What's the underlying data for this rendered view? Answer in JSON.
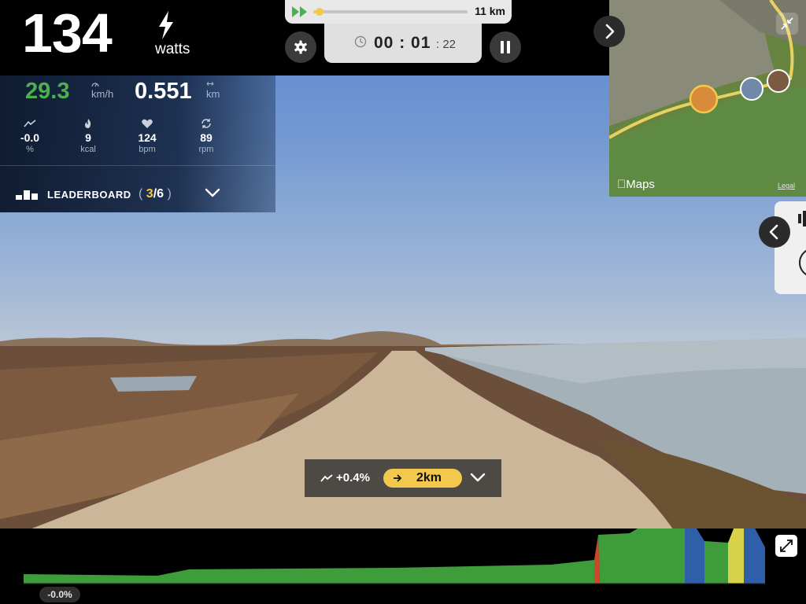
{
  "power": {
    "value": "134",
    "unit": "watts"
  },
  "route": {
    "total_distance": "11 km",
    "progress_fraction": 0.04
  },
  "timer": {
    "hours": "00",
    "minutes": "01",
    "seconds": "22"
  },
  "stats": {
    "speed": {
      "value": "29.3",
      "unit": "km/h"
    },
    "distance": {
      "value": "0.551",
      "unit": "km"
    },
    "metrics": [
      {
        "icon": "incline-icon",
        "value": "-0.0",
        "unit": "%"
      },
      {
        "icon": "flame-icon",
        "value": "9",
        "unit": "kcal"
      },
      {
        "icon": "heart-icon",
        "value": "124",
        "unit": "bpm"
      },
      {
        "icon": "cadence-icon",
        "value": "89",
        "unit": "rpm"
      }
    ]
  },
  "leaderboard": {
    "label": "LEADERBOARD",
    "open": "(",
    "position": "3",
    "separator": "/",
    "total": "6",
    "close": ")"
  },
  "map": {
    "logo": "Maps",
    "legal": "Legal"
  },
  "grade_bar": {
    "grade": "+0.4%",
    "next_distance": "2km"
  },
  "elevation": {
    "current_grade": "-0.0%"
  },
  "colors": {
    "accent_green": "#4caf50",
    "accent_yellow": "#f2c94c",
    "panel_navy": "#14264a",
    "elevation_blue": "#2f5fa8",
    "elevation_red": "#d1452c"
  }
}
